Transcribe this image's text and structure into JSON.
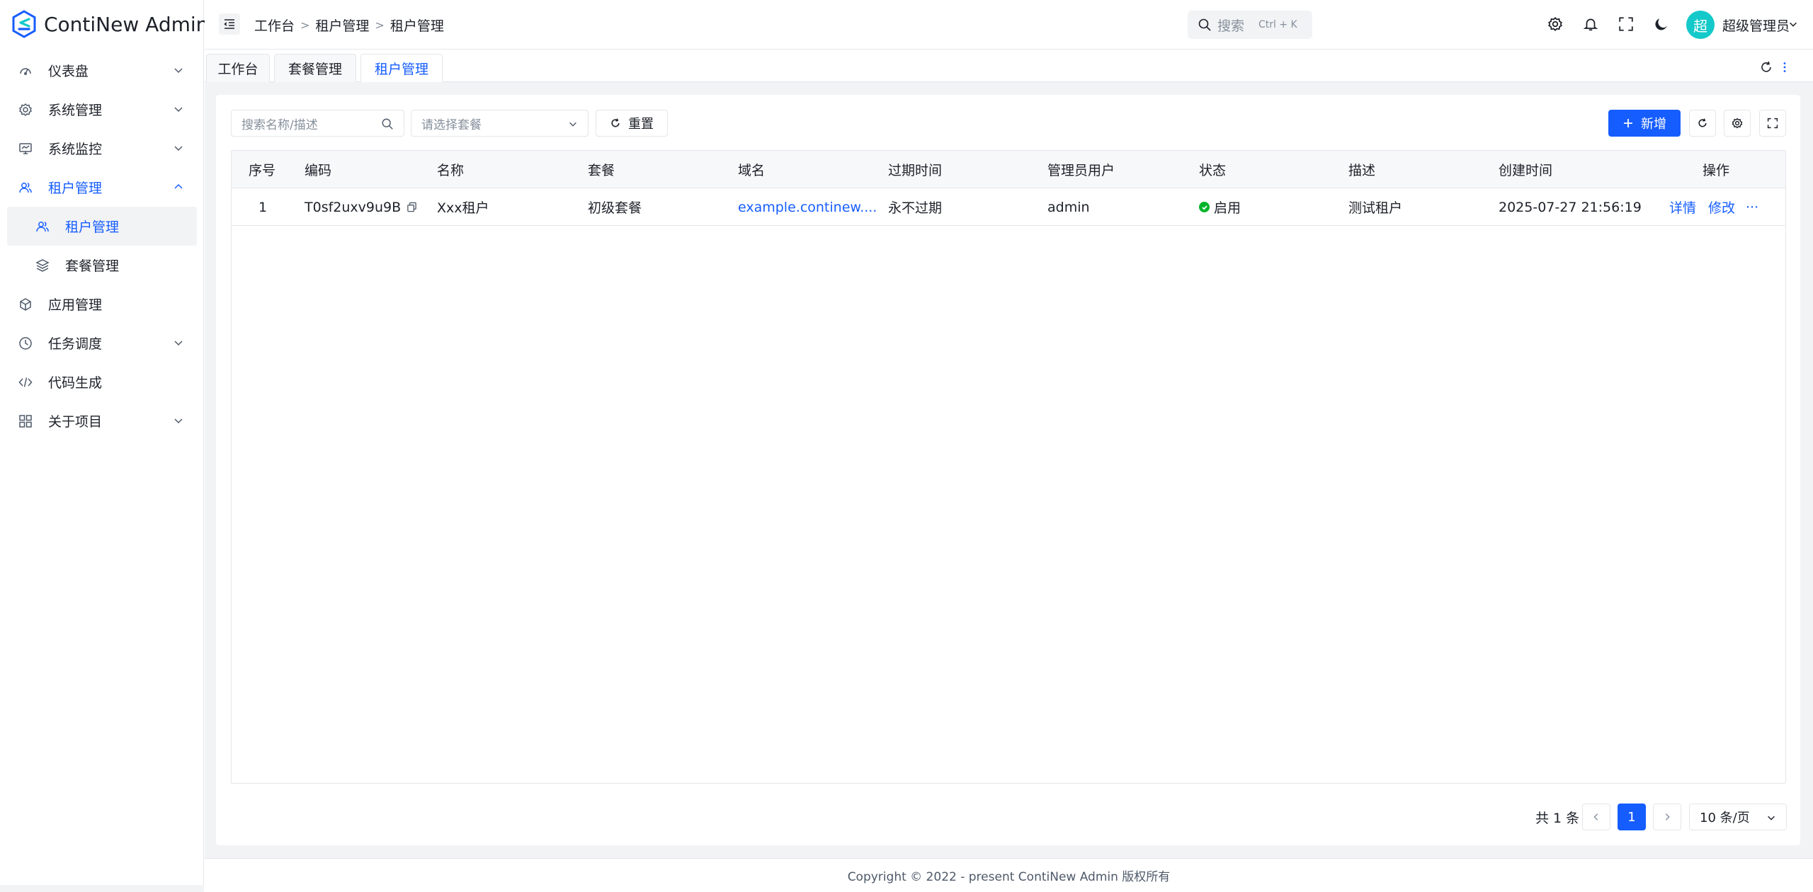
{
  "app": {
    "title": "ContiNew Admin"
  },
  "sidebar": {
    "items": [
      {
        "label": "仪表盘",
        "icon": "dashboard-icon",
        "has_children": true,
        "expanded": false
      },
      {
        "label": "系统管理",
        "icon": "gear-icon",
        "has_children": true,
        "expanded": false
      },
      {
        "label": "系统监控",
        "icon": "monitor-icon",
        "has_children": true,
        "expanded": false
      },
      {
        "label": "租户管理",
        "icon": "users-icon",
        "has_children": true,
        "expanded": true,
        "children": [
          {
            "label": "租户管理",
            "icon": "user-icon",
            "selected": true
          },
          {
            "label": "套餐管理",
            "icon": "layers-icon",
            "selected": false
          }
        ]
      },
      {
        "label": "应用管理",
        "icon": "cube-icon",
        "has_children": false
      },
      {
        "label": "任务调度",
        "icon": "clock-icon",
        "has_children": true,
        "expanded": false
      },
      {
        "label": "代码生成",
        "icon": "code-icon",
        "has_children": false
      },
      {
        "label": "关于项目",
        "icon": "apps-icon",
        "has_children": true,
        "expanded": false
      }
    ]
  },
  "header": {
    "breadcrumb": [
      "工作台",
      "租户管理",
      "租户管理"
    ],
    "search": {
      "placeholder": "搜索",
      "shortcut": "Ctrl + K"
    },
    "user": {
      "avatar_text": "超",
      "name": "超级管理员"
    },
    "avatar_color": "#14c9c9"
  },
  "tabs": [
    {
      "label": "工作台",
      "active": false
    },
    {
      "label": "套餐管理",
      "active": false
    },
    {
      "label": "租户管理",
      "active": true
    }
  ],
  "toolbar": {
    "search_placeholder": "搜索名称/描述",
    "package_placeholder": "请选择套餐",
    "reset_label": "重置",
    "add_label": "新增"
  },
  "table": {
    "columns": [
      "序号",
      "编码",
      "名称",
      "套餐",
      "域名",
      "过期时间",
      "管理员用户",
      "状态",
      "描述",
      "创建时间",
      "操作"
    ],
    "rows": [
      {
        "index": "1",
        "code": "T0sf2uxv9u9B",
        "name": "Xxx租户",
        "package": "初级套餐",
        "domain": "example.continew....",
        "expire": "永不过期",
        "admin": "admin",
        "status": "启用",
        "description": "测试租户",
        "created": "2025-07-27 21:56:19",
        "actions": {
          "detail": "详情",
          "edit": "修改",
          "more": "···"
        }
      }
    ]
  },
  "pagination": {
    "total": "共 1 条",
    "current": "1",
    "page_size": "10 条/页"
  },
  "footer": {
    "text": "Copyright © 2022 - present ContiNew Admin 版权所有"
  },
  "colors": {
    "primary": "#165dff",
    "success": "#00b42a",
    "border": "#e5e6eb",
    "bg": "#f2f3f5"
  }
}
